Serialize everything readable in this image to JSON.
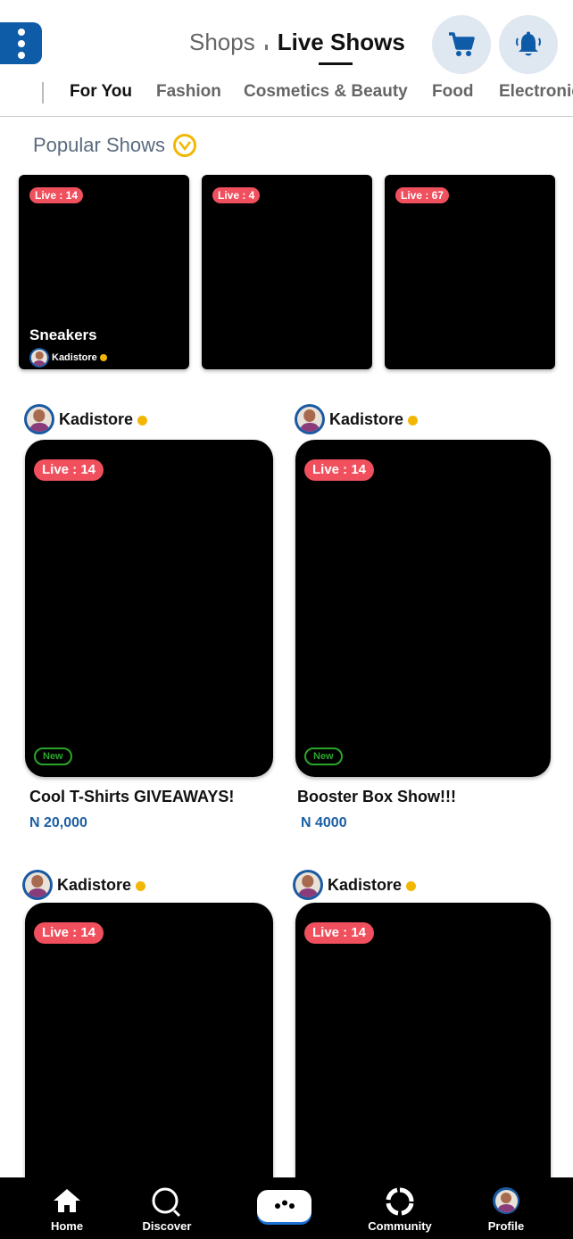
{
  "header": {
    "shops_label": "Shops",
    "live_label": "Live Shows"
  },
  "tabs": [
    "For You",
    "Fashion",
    "Cosmetics & Beauty",
    "Food",
    "Electronics"
  ],
  "popular": {
    "title": "Popular Shows",
    "cards": [
      {
        "live": "Live : 14",
        "title": "Sneakers",
        "seller": "Kadistore"
      },
      {
        "live": "Live : 4"
      },
      {
        "live": "Live : 67"
      }
    ]
  },
  "shows": [
    {
      "seller": "Kadistore",
      "live": "Live : 14",
      "badge": "New",
      "title": "Cool T-Shirts GIVEAWAYS!",
      "price": "N 20,000"
    },
    {
      "seller": "Kadistore",
      "live": "Live : 14",
      "badge": "New",
      "title": "Booster Box Show!!!",
      "price": "N 4000"
    },
    {
      "seller": "Kadistore",
      "live": "Live : 14"
    },
    {
      "seller": "Kadistore",
      "live": "Live : 14"
    }
  ],
  "nav": {
    "home": "Home",
    "discover": "Discover",
    "community": "Community",
    "profile": "Profile"
  },
  "colors": {
    "brand_blue": "#0e5ba8",
    "live_red": "#f0505d",
    "verified_gold": "#f2b705",
    "new_green": "#2aa52a",
    "price_blue": "#1c5fa4"
  }
}
